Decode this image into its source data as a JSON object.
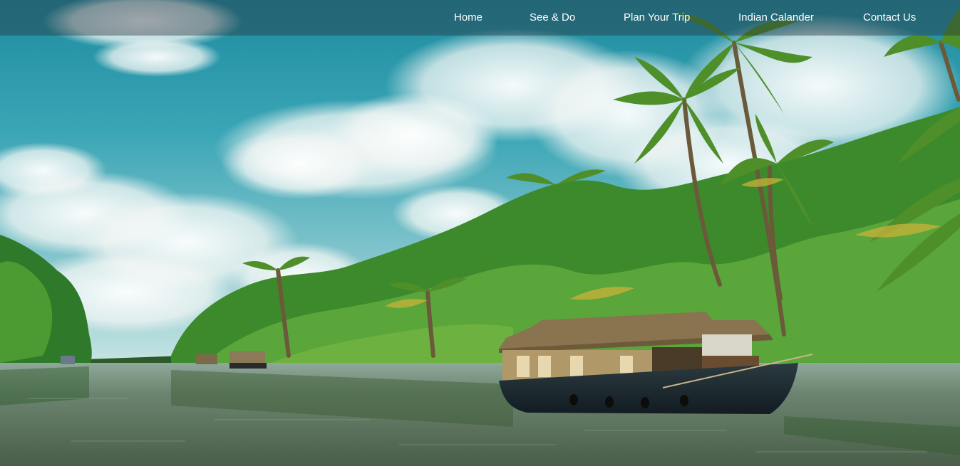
{
  "nav": {
    "items": [
      {
        "label": "Home"
      },
      {
        "label": "See & Do"
      },
      {
        "label": "Plan Your Trip"
      },
      {
        "label": "Indian Calander"
      },
      {
        "label": "Contact Us"
      }
    ]
  },
  "hero": {
    "image_subject": "backwater-houseboat-scene"
  },
  "colors": {
    "nav_bg": "#28323c",
    "nav_text": "#ffffff",
    "sky": "#3fa3b1",
    "water": "#5f7560",
    "foliage": "#3f8a2d"
  }
}
